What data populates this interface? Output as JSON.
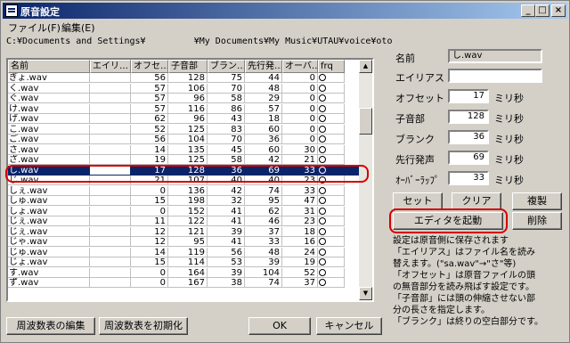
{
  "window": {
    "title": "原音設定",
    "minimize": "_",
    "maximize": "□",
    "close": "×"
  },
  "menu": {
    "file": "ファイル(F)",
    "edit": "編集(E)"
  },
  "path": "C:¥Documents and Settings¥         ¥My Documents¥My Music¥UTAU¥voice¥oto",
  "columns": [
    "名前",
    "エイリ…",
    "オフセ…",
    "子音部",
    "ブラン…",
    "先行発…",
    "オーバ…",
    "frq"
  ],
  "rows": [
    [
      "ぎょ.wav",
      "",
      "56",
      "128",
      "75",
      "44",
      "0",
      "○"
    ],
    [
      "く.wav",
      "",
      "57",
      "106",
      "70",
      "48",
      "0",
      "○"
    ],
    [
      "ぐ.wav",
      "",
      "57",
      "96",
      "58",
      "29",
      "0",
      "○"
    ],
    [
      "け.wav",
      "",
      "57",
      "116",
      "86",
      "57",
      "0",
      "○"
    ],
    [
      "げ.wav",
      "",
      "62",
      "96",
      "43",
      "18",
      "0",
      "○"
    ],
    [
      "こ.wav",
      "",
      "52",
      "125",
      "83",
      "60",
      "0",
      "○"
    ],
    [
      "ご.wav",
      "",
      "56",
      "104",
      "70",
      "36",
      "0",
      "○"
    ],
    [
      "さ.wav",
      "",
      "14",
      "135",
      "45",
      "60",
      "30",
      "○"
    ],
    [
      "ざ.wav",
      "",
      "19",
      "125",
      "58",
      "42",
      "21",
      "○"
    ],
    [
      "し.wav",
      "",
      "17",
      "128",
      "36",
      "69",
      "33",
      "○"
    ],
    [
      "じ.wav",
      "",
      "21",
      "107",
      "40",
      "40",
      "23",
      "○"
    ],
    [
      "しぇ.wav",
      "",
      "0",
      "136",
      "42",
      "74",
      "33",
      "○"
    ],
    [
      "しゅ.wav",
      "",
      "15",
      "198",
      "32",
      "95",
      "47",
      "○"
    ],
    [
      "しょ.wav",
      "",
      "0",
      "152",
      "41",
      "62",
      "31",
      "○"
    ],
    [
      "じぇ.wav",
      "",
      "11",
      "122",
      "41",
      "46",
      "23",
      "○"
    ],
    [
      "じぇ.wav",
      "",
      "12",
      "121",
      "39",
      "37",
      "18",
      "○"
    ],
    [
      "じゃ.wav",
      "",
      "12",
      "95",
      "41",
      "33",
      "16",
      "○"
    ],
    [
      "じゅ.wav",
      "",
      "14",
      "119",
      "56",
      "48",
      "24",
      "○"
    ],
    [
      "じょ.wav",
      "",
      "15",
      "114",
      "53",
      "39",
      "19",
      "○"
    ],
    [
      "す.wav",
      "",
      "0",
      "164",
      "39",
      "104",
      "52",
      "○"
    ],
    [
      "ず.wav",
      "",
      "0",
      "167",
      "38",
      "74",
      "37",
      "○"
    ]
  ],
  "selected_row": 9,
  "form": {
    "name_label": "名前",
    "name_value": "し.wav",
    "alias_label": "エイリアス",
    "alias_value": "",
    "offset_label": "オフセット",
    "offset_value": "17",
    "consonant_label": "子音部",
    "consonant_value": "128",
    "blank_label": "ブランク",
    "blank_value": "36",
    "preutter_label": "先行発声",
    "preutter_value": "69",
    "overlap_label": "ｵｰﾊﾞｰﾗｯﾌﾟ",
    "overlap_value": "33",
    "unit": "ミリ秒"
  },
  "buttons": {
    "set": "セット",
    "clear": "クリア",
    "copy": "複製",
    "launch_editor": "エディタを起動",
    "delete": "削除",
    "edit_freq": "周波数表の編集",
    "init_freq": "周波数表を初期化",
    "ok": "OK",
    "cancel": "キャンセル"
  },
  "help": [
    "設定は原音側に保存されます",
    "「エイリアス」はファイル名を読み",
    "替えます。(\"sa.wav\"→\"さ\"等)",
    "「オフセット」は原音ファイルの頭",
    "の無音部分を読み飛ばす設定です。",
    "「子音部」には頭の伸縮させない部",
    "分の長さを指定します。",
    "「ブランク」は終りの空白部分です。"
  ],
  "colors": {
    "selection": "#0a246a",
    "highlight": "#d40000",
    "face": "#d4d0c8"
  }
}
